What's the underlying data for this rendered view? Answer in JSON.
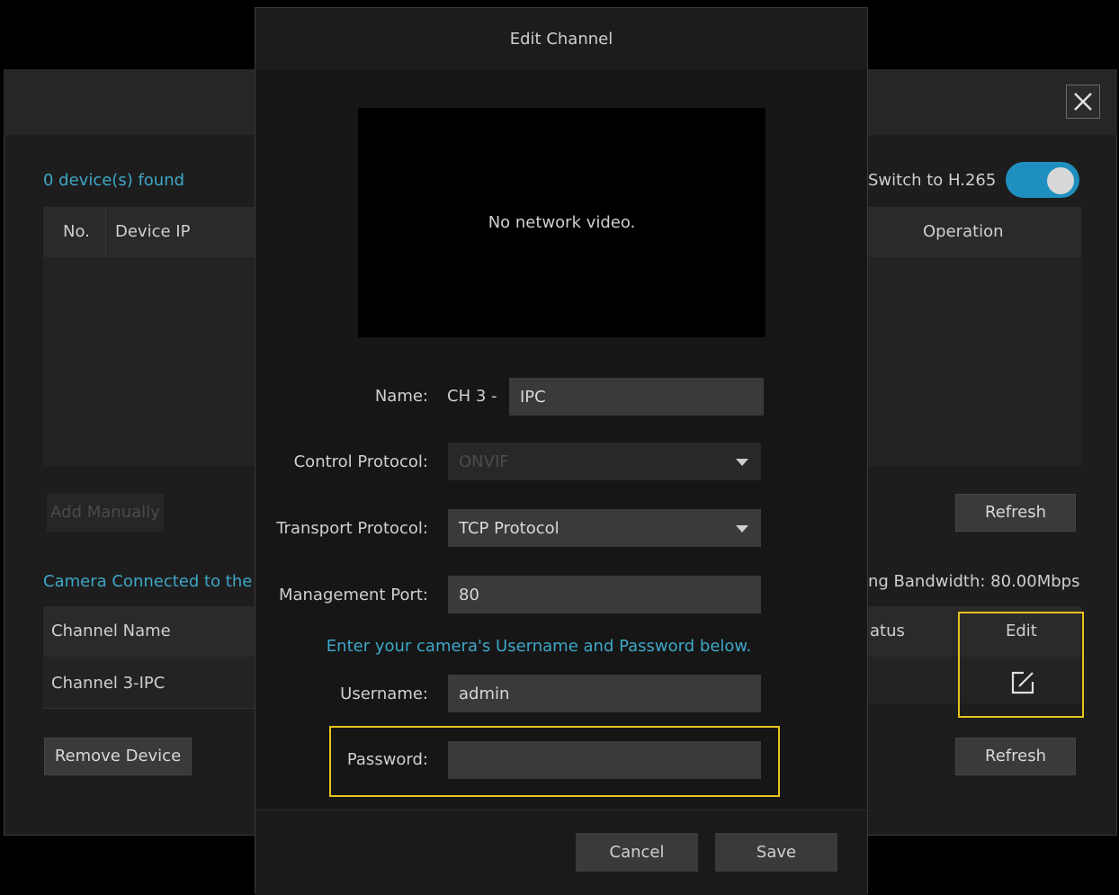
{
  "background_window": {
    "devices_found": "0 device(s) found",
    "switch_label": "Switch to H.265",
    "switch_on": true,
    "device_table": {
      "headers": [
        "No.",
        "Device IP",
        "Operation"
      ]
    },
    "add_manually_label": "Add Manually",
    "refresh_label": "Refresh",
    "camera_connected_label": "Camera Connected to the",
    "bandwidth_label": "ng Bandwidth: 80.00Mbps",
    "channel_table": {
      "headers": [
        "Channel Name",
        "atus",
        "Edit"
      ],
      "rows": [
        {
          "name": "Channel 3-IPC"
        }
      ]
    },
    "remove_device_label": "Remove Device",
    "refresh2_label": "Refresh",
    "close_icon": "close-icon",
    "edit_icon": "edit-icon"
  },
  "modal": {
    "title": "Edit Channel",
    "video_message": "No network video.",
    "name_label": "Name:",
    "name_prefix": "CH 3 -",
    "name_value": "IPC",
    "control_protocol_label": "Control Protocol:",
    "control_protocol_value": "ONVIF",
    "transport_protocol_label": "Transport Protocol:",
    "transport_protocol_value": "TCP Protocol",
    "management_port_label": "Management Port:",
    "management_port_value": "80",
    "hint": "Enter your camera's Username and Password below.",
    "username_label": "Username:",
    "username_value": "admin",
    "password_label": "Password:",
    "password_value": "",
    "cancel_label": "Cancel",
    "save_label": "Save"
  },
  "colors": {
    "accent": "#1f8fc0",
    "highlight": "#e6c31c",
    "link_text": "#3fa7c9"
  }
}
